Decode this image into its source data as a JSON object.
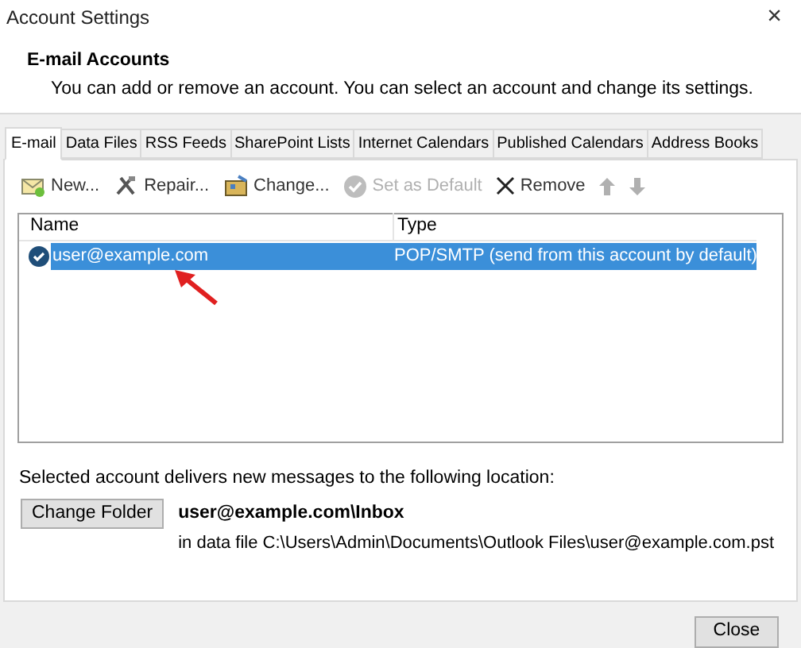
{
  "window": {
    "title": "Account Settings",
    "close": "×"
  },
  "header": {
    "title": "E-mail Accounts",
    "description": "You can add or remove an account. You can select an account and change its settings."
  },
  "tabs": [
    {
      "label": "E-mail",
      "selected": true
    },
    {
      "label": "Data Files",
      "selected": false
    },
    {
      "label": "RSS Feeds",
      "selected": false
    },
    {
      "label": "SharePoint Lists",
      "selected": false
    },
    {
      "label": "Internet Calendars",
      "selected": false
    },
    {
      "label": "Published Calendars",
      "selected": false
    },
    {
      "label": "Address Books",
      "selected": false
    }
  ],
  "toolbar": [
    {
      "kind": "new",
      "label": "New...",
      "disabled": false
    },
    {
      "kind": "repair",
      "label": "Repair...",
      "disabled": false
    },
    {
      "kind": "change",
      "label": "Change...",
      "disabled": false
    },
    {
      "kind": "default",
      "label": "Set as Default",
      "disabled": true
    },
    {
      "kind": "remove",
      "label": "Remove",
      "disabled": false
    },
    {
      "kind": "up",
      "disabled": true
    },
    {
      "kind": "down",
      "disabled": true
    }
  ],
  "accounts": {
    "columns": [
      "Name",
      "Type"
    ],
    "rows": [
      {
        "name": "user@example.com",
        "type": "POP/SMTP (send from this account by default)",
        "selected": true,
        "default": true
      }
    ]
  },
  "delivery": {
    "label": "Selected account delivers new messages to the following location:",
    "button": "Change Folder",
    "folder": "user@example.com\\Inbox",
    "data_file": "in data file C:\\Users\\Admin\\Documents\\Outlook Files\\user@example.com.pst"
  },
  "footer": {
    "button": "Close"
  }
}
